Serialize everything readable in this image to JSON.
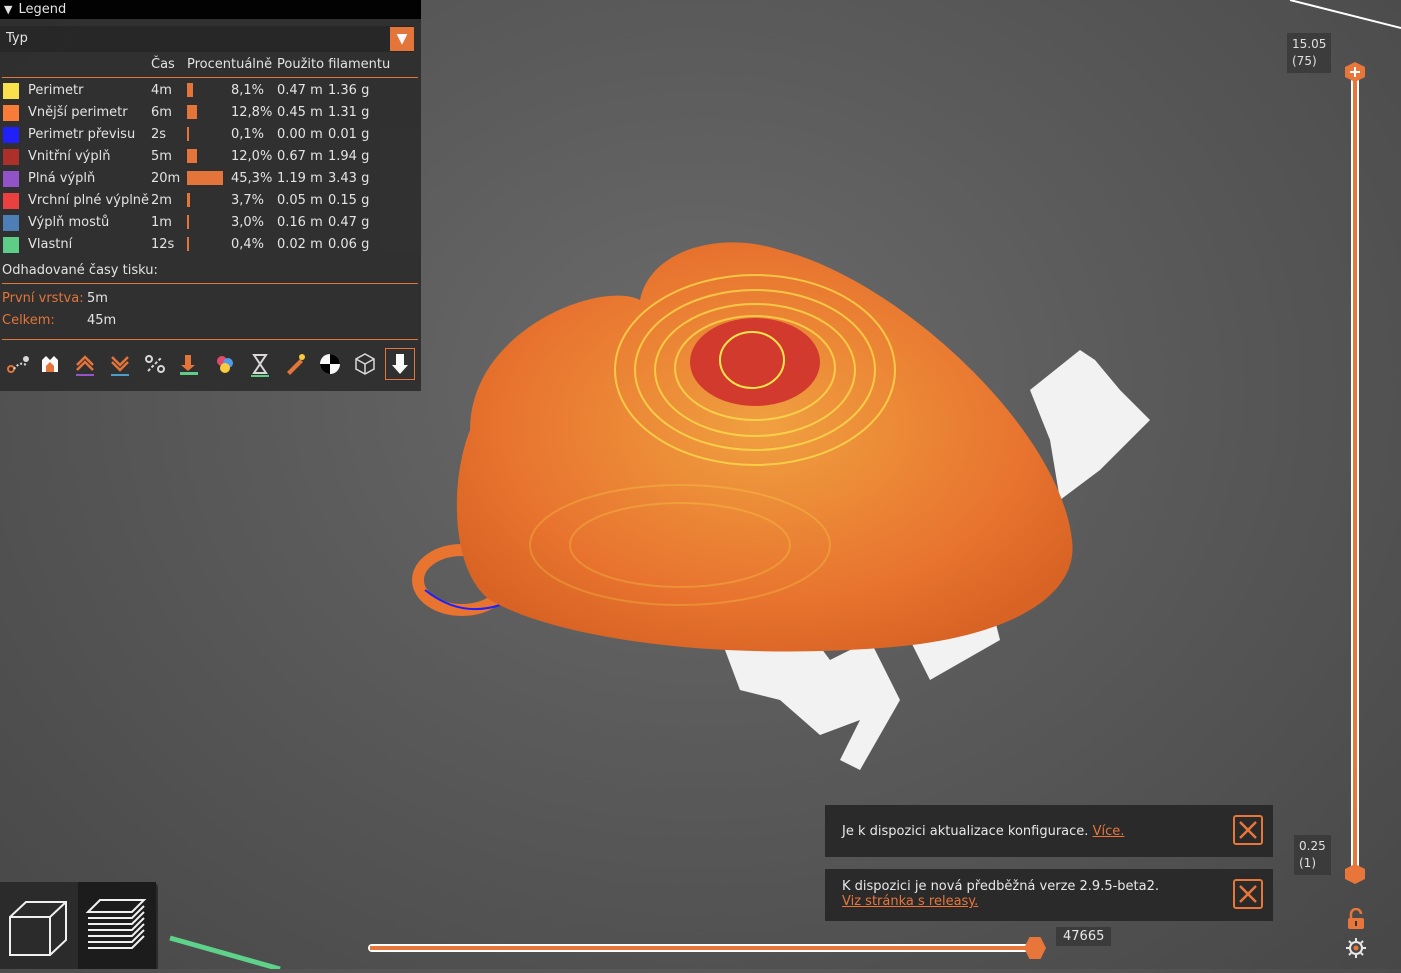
{
  "legend": {
    "title": "Legend",
    "type_label": "Typ",
    "headers": {
      "time": "Čas",
      "percent": "Procentuálně",
      "filament": "Použito filamentu"
    },
    "rows": [
      {
        "color": "#ffe64d",
        "name": "Perimetr",
        "time": "4m",
        "pct": "8,1%",
        "pct_value": 8.1,
        "len": "0.47 m",
        "weight": "1.36 g"
      },
      {
        "color": "#ff7d38",
        "name": "Vnější perimetr",
        "time": "6m",
        "pct": "12,8%",
        "pct_value": 12.8,
        "len": "0.45 m",
        "weight": "1.31 g"
      },
      {
        "color": "#1f1fff",
        "name": "Perimetr převisu",
        "time": "2s",
        "pct": "0,1%",
        "pct_value": 0.1,
        "len": "0.00 m",
        "weight": "0.01 g"
      },
      {
        "color": "#b03029",
        "name": "Vnitřní výplň",
        "time": "5m",
        "pct": "12,0%",
        "pct_value": 12.0,
        "len": "0.67 m",
        "weight": "1.94 g"
      },
      {
        "color": "#9654cc",
        "name": "Plná výplň",
        "time": "20m",
        "pct": "45,3%",
        "pct_value": 45.3,
        "len": "1.19 m",
        "weight": "3.43 g"
      },
      {
        "color": "#f04040",
        "name": "Vrchní plné výplně",
        "time": "2m",
        "pct": "3,7%",
        "pct_value": 3.7,
        "len": "0.05 m",
        "weight": "0.15 g"
      },
      {
        "color": "#4d80ba",
        "name": "Výplň mostů",
        "time": "1m",
        "pct": "3,0%",
        "pct_value": 3.0,
        "len": "0.16 m",
        "weight": "0.47 g"
      },
      {
        "color": "#5ed18a",
        "name": "Vlastní",
        "time": "12s",
        "pct": "0,4%",
        "pct_value": 0.4,
        "len": "0.02 m",
        "weight": "0.06 g"
      }
    ],
    "estimated_label": "Odhadované časy tisku:",
    "first_layer_label": "První vrstva:",
    "first_layer_value": "5m",
    "total_label": "Celkem:",
    "total_value": "45m",
    "toolbar_icons": [
      "travel-icon",
      "retractions-icon",
      "deretractions-icon",
      "tool-changes-icon",
      "color-changes-icon",
      "pause-icon",
      "custom-gcode-icon",
      "color-print-icon",
      "time-icon",
      "seams-icon",
      "center-of-gravity-icon",
      "shells-icon",
      "tool-marker-icon"
    ]
  },
  "vertical_slider": {
    "top_value": "15.05",
    "top_layer": "(75)",
    "bottom_value": "0.25",
    "bottom_layer": "(1)"
  },
  "horizontal_slider": {
    "value": "47665"
  },
  "notifications": [
    {
      "text": "Je k dispozici aktualizace konfigurace.",
      "link": "Více."
    },
    {
      "text": "K dispozici je nová předběžná verze 2.9.5-beta2.",
      "link": "Viz stránka s releasy."
    }
  ],
  "accent_color": "#e8763a"
}
